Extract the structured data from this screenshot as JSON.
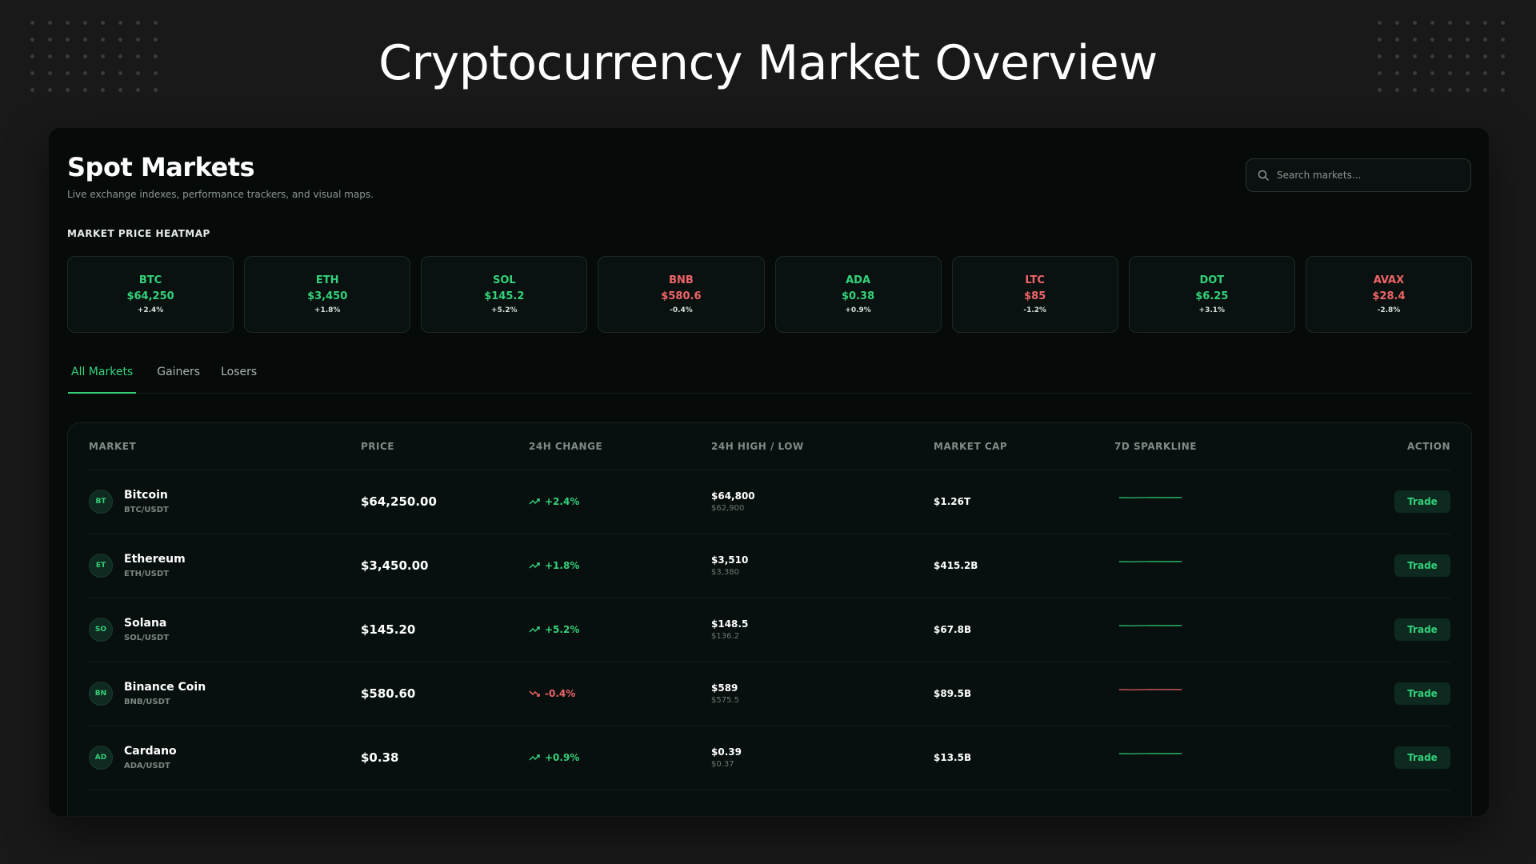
{
  "page_title": "Cryptocurrency Market Overview",
  "colors": {
    "accent": "#34d17a",
    "negative": "#f0646a",
    "background": "#191919",
    "panel": "#060b0a"
  },
  "header": {
    "title": "Spot Markets",
    "subtitle": "Live exchange indexes, performance trackers, and visual maps."
  },
  "search": {
    "placeholder": "Search markets...",
    "value": "",
    "icon": "search-icon"
  },
  "heatmap": {
    "label": "MARKET PRICE HEATMAP",
    "tiles": [
      {
        "symbol": "BTC",
        "price": "$64,250",
        "change": "+2.4%",
        "direction": "up"
      },
      {
        "symbol": "ETH",
        "price": "$3,450",
        "change": "+1.8%",
        "direction": "up"
      },
      {
        "symbol": "SOL",
        "price": "$145.2",
        "change": "+5.2%",
        "direction": "up"
      },
      {
        "symbol": "BNB",
        "price": "$580.6",
        "change": "-0.4%",
        "direction": "down"
      },
      {
        "symbol": "ADA",
        "price": "$0.38",
        "change": "+0.9%",
        "direction": "up"
      },
      {
        "symbol": "LTC",
        "price": "$85",
        "change": "-1.2%",
        "direction": "down"
      },
      {
        "symbol": "DOT",
        "price": "$6.25",
        "change": "+3.1%",
        "direction": "up"
      },
      {
        "symbol": "AVAX",
        "price": "$28.4",
        "change": "-2.8%",
        "direction": "down"
      }
    ]
  },
  "tabs": [
    {
      "label": "All Markets",
      "active": true
    },
    {
      "label": "Gainers",
      "active": false
    },
    {
      "label": "Losers",
      "active": false
    }
  ],
  "table": {
    "columns": [
      "MARKET",
      "PRICE",
      "24H CHANGE",
      "24H HIGH / LOW",
      "MARKET CAP",
      "7D SPARKLINE",
      "ACTION"
    ],
    "rows": [
      {
        "avatar": "BT",
        "name": "Bitcoin",
        "pair": "BTC/USDT",
        "price": "$64,250.00",
        "change": "+2.4%",
        "direction": "up",
        "high": "$64,800",
        "low": "$62,900",
        "market_cap": "$1.26T",
        "action": "Trade"
      },
      {
        "avatar": "ET",
        "name": "Ethereum",
        "pair": "ETH/USDT",
        "price": "$3,450.00",
        "change": "+1.8%",
        "direction": "up",
        "high": "$3,510",
        "low": "$3,380",
        "market_cap": "$415.2B",
        "action": "Trade"
      },
      {
        "avatar": "SO",
        "name": "Solana",
        "pair": "SOL/USDT",
        "price": "$145.20",
        "change": "+5.2%",
        "direction": "up",
        "high": "$148.5",
        "low": "$136.2",
        "market_cap": "$67.8B",
        "action": "Trade"
      },
      {
        "avatar": "BN",
        "name": "Binance Coin",
        "pair": "BNB/USDT",
        "price": "$580.60",
        "change": "-0.4%",
        "direction": "down",
        "high": "$589",
        "low": "$575.5",
        "market_cap": "$89.5B",
        "action": "Trade"
      },
      {
        "avatar": "AD",
        "name": "Cardano",
        "pair": "ADA/USDT",
        "price": "$0.38",
        "change": "+0.9%",
        "direction": "up",
        "high": "$0.39",
        "low": "$0.37",
        "market_cap": "$13.5B",
        "action": "Trade"
      }
    ]
  }
}
